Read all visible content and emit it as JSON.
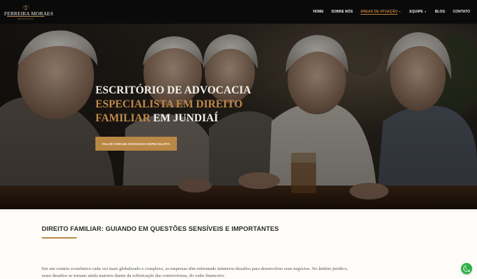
{
  "brand": {
    "name": "FERREIRA MORAES",
    "subtitle": "ADVOCACIA",
    "accent": "#b98846"
  },
  "nav": {
    "items": [
      {
        "label": "HOME",
        "active": false,
        "dropdown": false
      },
      {
        "label": "SOBRE NÓS",
        "active": false,
        "dropdown": false
      },
      {
        "label": "ÁREAS DE ATUAÇÃO",
        "active": true,
        "dropdown": true
      },
      {
        "label": "EQUIPE",
        "active": false,
        "dropdown": true
      },
      {
        "label": "BLOG",
        "active": false,
        "dropdown": false
      },
      {
        "label": "CONTATO",
        "active": false,
        "dropdown": false
      }
    ]
  },
  "hero": {
    "line1": "ESCRITÓRIO DE ADVOCACIA",
    "line2_gold": "ESPECIALISTA EM DIREITO",
    "line3_gold": "FAMILIAR",
    "line3_rest": " EM JUNDIAÍ",
    "cta_label": "FALAR COM UM ADVOGADO ESPECIALISTA",
    "image": "elderly-friends-laughing-photo"
  },
  "section": {
    "title": "DIREITO FAMILIAR: GUIANDO EM QUESTÕES SENSÍVEIS E IMPORTANTES",
    "paragraph": "Em um cenário econômico cada vez mais globalizado e complexo, as empresas têm enfrentado inúmeros desafios para desenvolver seus negócios. No âmbito jurídico, esses desafios se tornam ainda maiores diante da sofisticação das controvérsias, do vulto financeiro"
  },
  "floating": {
    "whatsapp_icon": "whatsapp-icon",
    "color": "#2fb14a"
  }
}
